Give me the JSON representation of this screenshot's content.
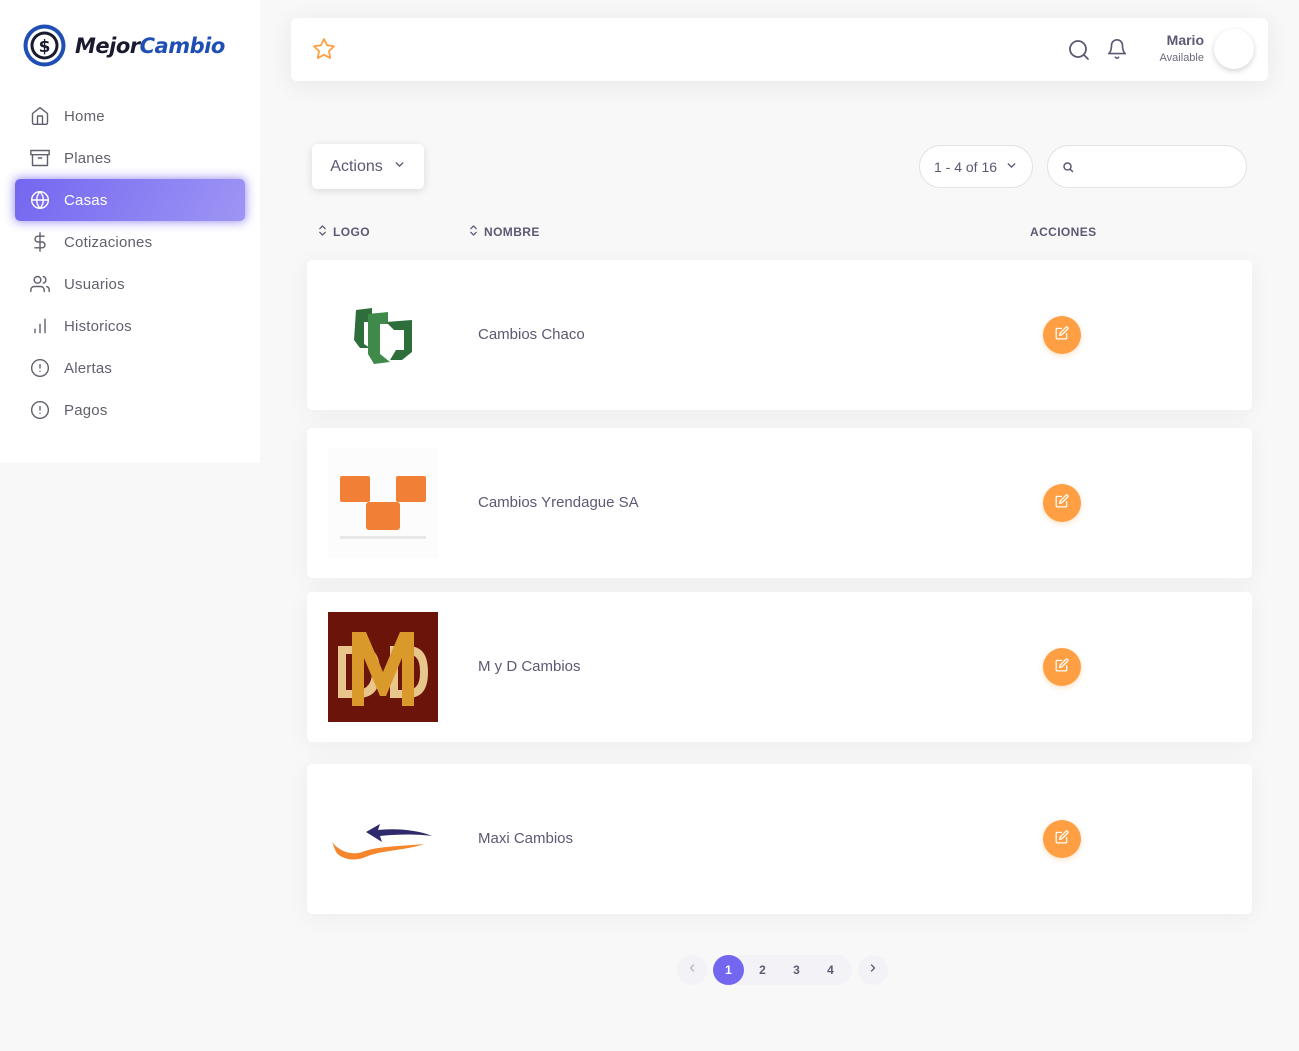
{
  "brand": {
    "part1": "Mejor",
    "part2": "Cambio"
  },
  "sidebar": {
    "items": [
      {
        "label": "Home",
        "icon": "home-icon"
      },
      {
        "label": "Planes",
        "icon": "archive-icon"
      },
      {
        "label": "Casas",
        "icon": "globe-icon",
        "active": true
      },
      {
        "label": "Cotizaciones",
        "icon": "dollar-icon"
      },
      {
        "label": "Usuarios",
        "icon": "users-icon"
      },
      {
        "label": "Historicos",
        "icon": "bar-chart-icon"
      },
      {
        "label": "Alertas",
        "icon": "alert-circle-icon"
      },
      {
        "label": "Pagos",
        "icon": "alert-circle-icon"
      }
    ]
  },
  "navbar": {
    "user_name": "Mario",
    "user_status": "Available"
  },
  "toolbar": {
    "actions_label": "Actions",
    "range_label": "1 - 4 of 16",
    "search_placeholder": ""
  },
  "table": {
    "columns": {
      "logo": "LOGO",
      "nombre": "NOMBRE",
      "acciones": "ACCIONES"
    },
    "rows": [
      {
        "name": "Cambios Chaco"
      },
      {
        "name": "Cambios Yrendague SA"
      },
      {
        "name": "M y D Cambios"
      },
      {
        "name": "Maxi Cambios"
      }
    ]
  },
  "pagination": {
    "pages": [
      "1",
      "2",
      "3",
      "4"
    ],
    "current": "1"
  },
  "colors": {
    "primary": "#7367f0",
    "warning": "#ff9f43",
    "text": "#5e5873"
  }
}
